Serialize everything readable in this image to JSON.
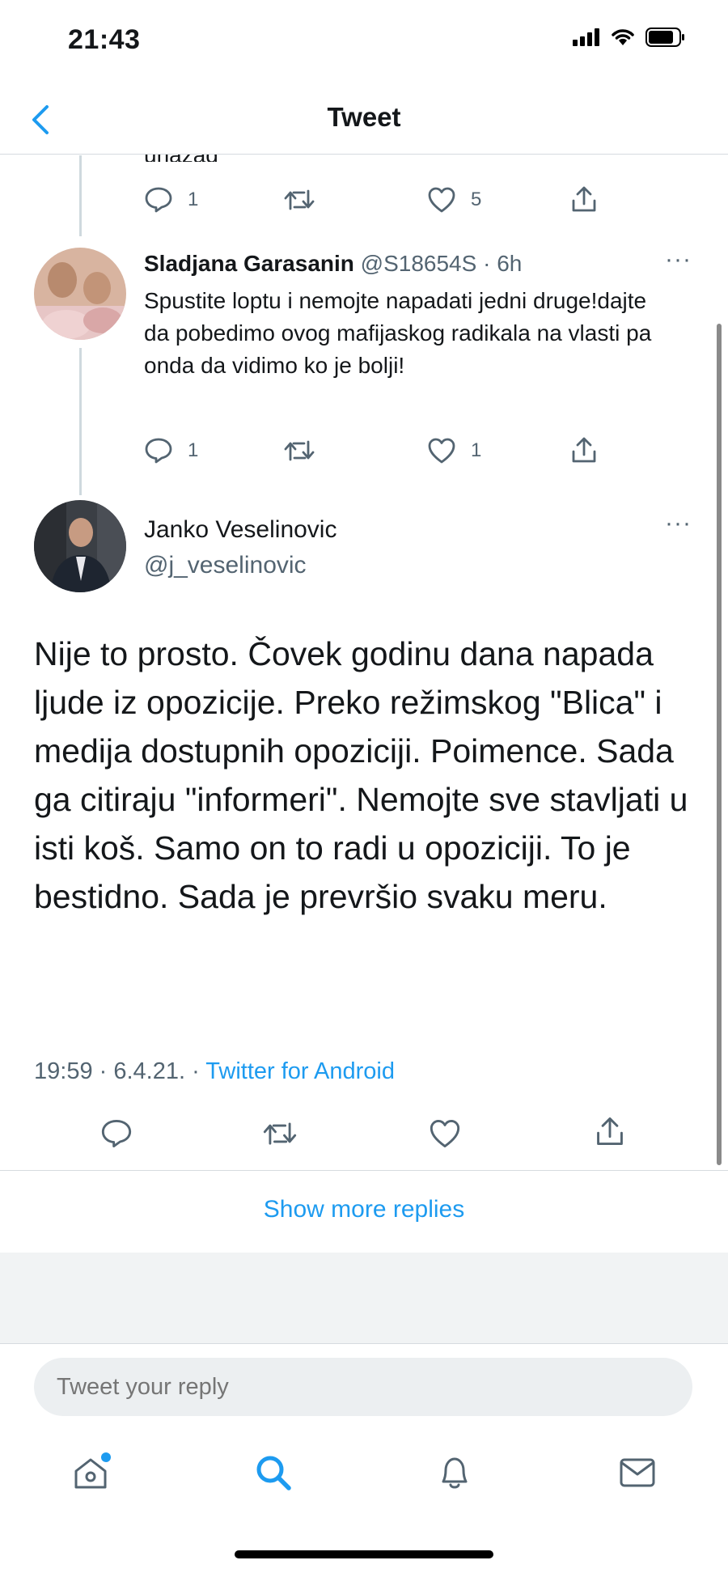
{
  "status_bar": {
    "time": "21:43"
  },
  "header": {
    "title": "Tweet"
  },
  "prev_tweet": {
    "clipped_text": "unazad",
    "actions": {
      "reply_count": "1",
      "retweet_count": "",
      "like_count": "5"
    }
  },
  "reply": {
    "name": "Sladjana Garasanin",
    "handle_time": "@S18654S · 6h",
    "more": "···",
    "text": "Spustite loptu i nemojte napadati jedni druge!dajte da pobedimo ovog mafijaskog radikala na vlasti pa onda da vidimo ko je bolji!",
    "actions": {
      "reply_count": "1",
      "retweet_count": "",
      "like_count": "1"
    }
  },
  "main_tweet": {
    "name": "Janko Veselinovic",
    "handle": "@j_veselinovic",
    "more": "···",
    "text": "Nije to prosto. Čovek godinu dana napada ljude iz opozicije. Preko režimskog \"Blica\" i medija dostupnih opoziciji. Poimence.  Sada ga citiraju \"informeri\". Nemojte sve stavljati u isti koš. Samo on to radi u opoziciji. To je bestidno. Sada je prevršio svaku meru.",
    "meta_time": "19:59 · 6.4.21. · ",
    "meta_source": "Twitter for Android"
  },
  "show_more": "Show more replies",
  "reply_input": {
    "placeholder": "Tweet your reply"
  },
  "icons": [
    "back-icon",
    "signal-icon",
    "wifi-icon",
    "battery-icon",
    "reply-icon",
    "retweet-icon",
    "like-icon",
    "share-icon",
    "home-icon",
    "search-icon",
    "notifications-icon",
    "messages-icon"
  ],
  "colors": {
    "accent": "#1d9bf0",
    "secondary_text": "#536471",
    "separator": "#d6dbdf"
  }
}
